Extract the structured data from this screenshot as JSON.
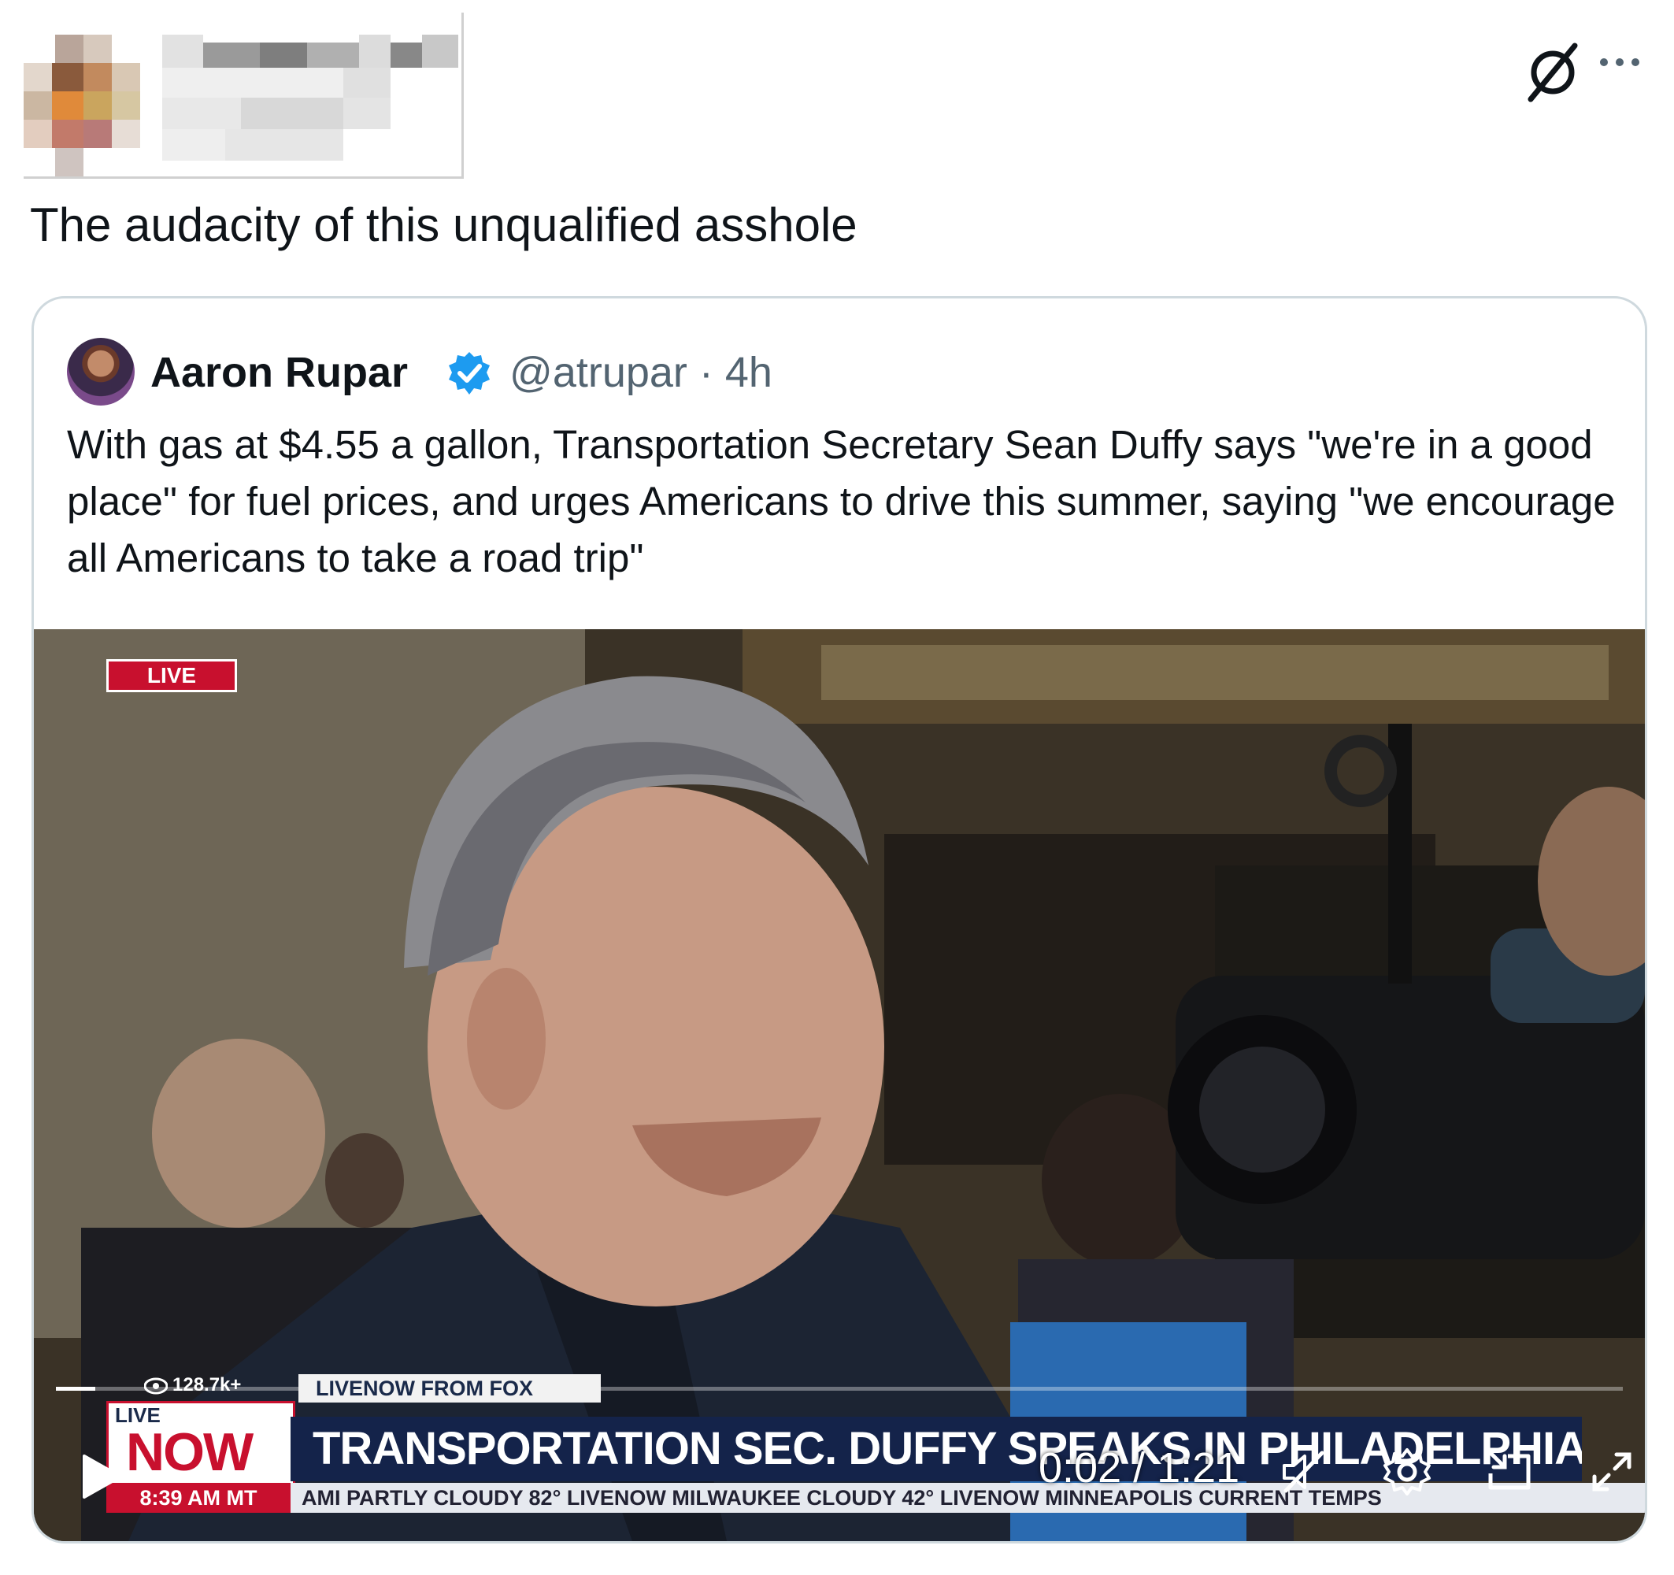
{
  "post": {
    "text": "The audacity of this unqualified asshole"
  },
  "quoted_tweet": {
    "author_name": "Aaron Rupar",
    "handle_and_time": "@atrupar · 4h",
    "text": "With gas at $4.55 a gallon, Transportation Secretary Sean Duffy says \"we're in a good place\" for fuel prices, and urges Americans to drive this summer, saying \"we encourage all Americans to take a road trip\""
  },
  "video": {
    "live_tag": "LIVE",
    "views": "128.7k+",
    "source_banner": "LIVENOW FROM FOX",
    "live_small": "LIVE",
    "now_label": "NOW",
    "clock": "8:39 AM MT",
    "headline": "TRANSPORTATION SEC. DUFFY SPEAKS IN PHILADELPHIA, PA",
    "ticker": "AMI   PARTLY CLOUDY 82°   LIVENOW   MILWAUKEE   CLOUDY 42°   LIVENOW   MINNEAPOLIS   CURRENT TEMPS",
    "time_readout": "0:02 / 1:21",
    "progress_fraction": 0.025,
    "controls": [
      "play-icon",
      "mute-icon",
      "settings-icon",
      "pip-icon",
      "fullscreen-icon"
    ]
  },
  "icons": {
    "top_right": [
      "grok-slash-icon",
      "more-icon"
    ]
  },
  "colors": {
    "verified": "#1d9bf0",
    "secondary_text": "#536471",
    "card_border": "#cfd9de",
    "news_red": "#c8102e",
    "news_navy": "#14234a"
  }
}
